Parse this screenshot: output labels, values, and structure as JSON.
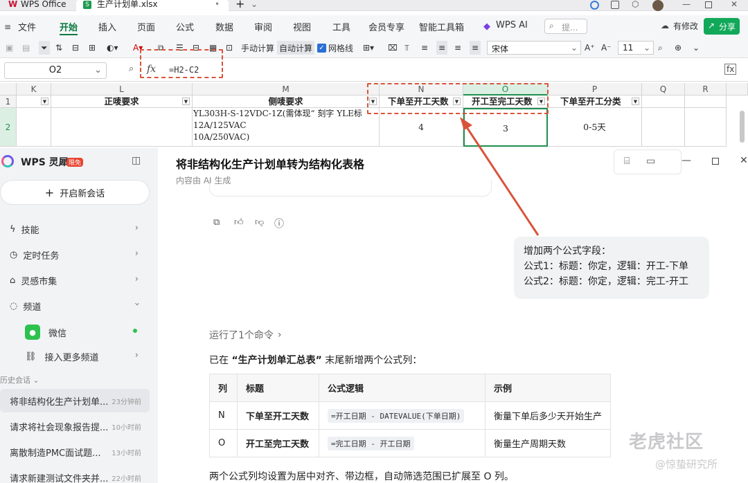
{
  "titlebar": {
    "app_name": "WPS Office",
    "file_tab": "生产计划单.xlsx",
    "tab_close": "•",
    "add_tab": "+"
  },
  "ribbon": {
    "file_menu": "文件",
    "tabs": [
      "开始",
      "插入",
      "页面",
      "公式",
      "数据",
      "审阅",
      "视图",
      "工具",
      "会员专享",
      "智能工具箱"
    ],
    "wps_ai": "WPS AI",
    "search_placeholder": "提...",
    "changes": "有修改",
    "share": "分享"
  },
  "toolbar": {
    "manual_calc": "手动计算",
    "auto_calc": "自动计算",
    "gridlines": "网格线",
    "font": "宋体",
    "font_size": "11"
  },
  "formula_bar": {
    "name_box": "O2",
    "fx": "fx",
    "formula": "=H2-C2"
  },
  "sheet": {
    "columns": [
      "K",
      "L",
      "M",
      "N",
      "O",
      "P",
      "Q",
      "R"
    ],
    "rows": [
      "1",
      "2"
    ],
    "headers": {
      "L": "正唛要求",
      "M": "侧唛要求",
      "N": "下单至开工天数",
      "O": "开工至完工天数",
      "P": "下单至开工分类"
    },
    "row2": {
      "M_line1": "YL303H-S-12VDC-1Z(需体现“ 刻字 YLE标",
      "M_line2": "12A/125VAC",
      "M_line3": "10A/250VAC)",
      "N": "4",
      "O": "3",
      "P": "0-5天"
    }
  },
  "sidebar": {
    "brand": "WPS 灵犀",
    "badge": "限免",
    "new_chat": "开启新会话",
    "items": [
      {
        "label": "技能"
      },
      {
        "label": "定时任务"
      },
      {
        "label": "灵感市集"
      },
      {
        "label": "频道"
      }
    ],
    "sub_items": [
      {
        "label": "微信"
      },
      {
        "label": "接入更多频道"
      }
    ],
    "history_label": "历史会话",
    "history": [
      {
        "title": "将非结构化生产计划单...",
        "time": "23分钟前"
      },
      {
        "title": "请求将社会现象报告提...",
        "time": "10小时前"
      },
      {
        "title": "离散制造PMC面试题...",
        "time": "13小时前"
      },
      {
        "title": "请求新建测试文件夹并...",
        "time": "22小时前"
      }
    ]
  },
  "main": {
    "title": "将非结构化生产计划单转为结构化表格",
    "subtitle": "内容由 AI 生成",
    "user_msg": [
      "增加两个公式字段：",
      "公式1：标题：你定，逻辑：开工-下单",
      "公式2：标题：你定，逻辑：完工-开工"
    ],
    "ran_cmd": "运行了1个命令",
    "response_prefix": "已在 ",
    "response_sheet": "“生产计划单汇总表”",
    "response_suffix": " 末尾新增两个公式列：",
    "table": {
      "headers": [
        "列",
        "标题",
        "公式逻辑",
        "示例"
      ],
      "rows": [
        {
          "col": "N",
          "title": "下单至开工天数",
          "formula": "=开工日期 - DATEVALUE(下单日期)",
          "example": "衡量下单后多少天开始生产"
        },
        {
          "col": "O",
          "title": "开工至完工天数",
          "formula": "=完工日期 - 开工日期",
          "example": "衡量生产周期天数"
        }
      ]
    },
    "footer": "两个公式列均设置为居中对齐、带边框，自动筛选范围已扩展至 O 列。"
  },
  "watermark": {
    "line1": "老虎社区",
    "line2": "@惊蛰研究所"
  },
  "colors": {
    "accent": "#0b7a3e",
    "annotation": "#d9533a",
    "sel": "#1f8f4e"
  }
}
